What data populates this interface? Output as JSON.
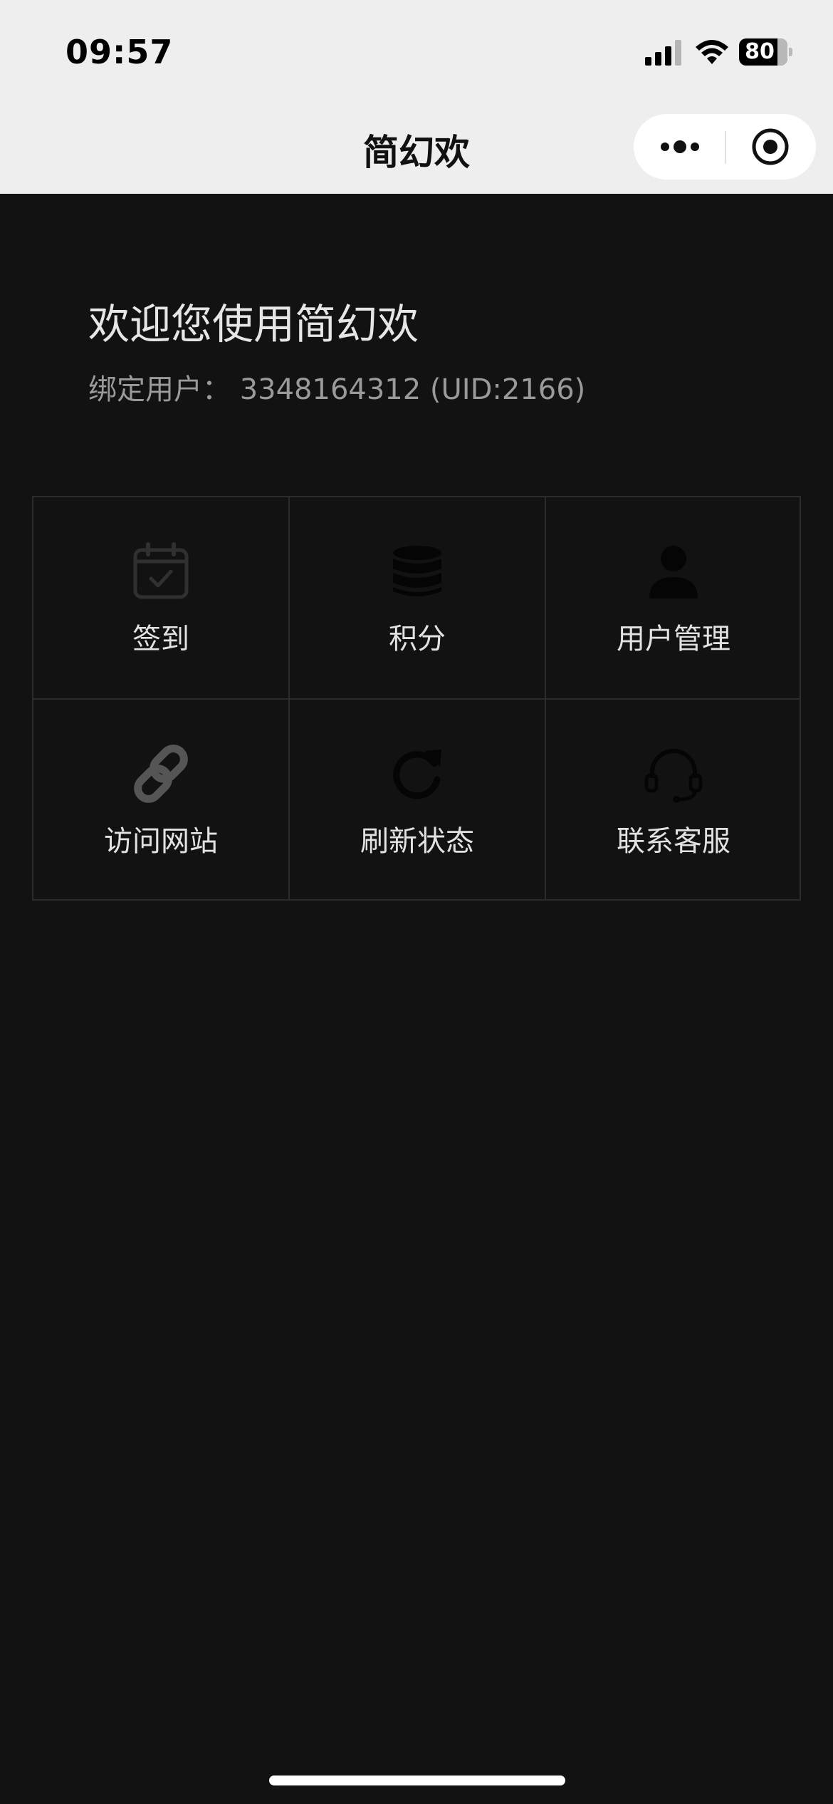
{
  "status_bar": {
    "time": "09:57",
    "battery_level": "80",
    "signal_icon": "signal-icon",
    "wifi_icon": "wifi-icon"
  },
  "nav": {
    "title": "简幻欢",
    "more_icon": "more-dots-icon",
    "close_icon": "capsule-close-icon"
  },
  "content": {
    "welcome": "欢迎您使用简幻欢",
    "bind_user": "绑定用户： 3348164312 (UID:2166)"
  },
  "grid": [
    {
      "label": "签到",
      "icon": "calendar-check-icon"
    },
    {
      "label": "积分",
      "icon": "database-coins-icon"
    },
    {
      "label": "用户管理",
      "icon": "user-icon"
    },
    {
      "label": "访问网站",
      "icon": "link-icon"
    },
    {
      "label": "刷新状态",
      "icon": "refresh-icon"
    },
    {
      "label": "联系客服",
      "icon": "headset-icon"
    }
  ],
  "colors": {
    "background": "#121212",
    "header": "#eeeeee",
    "icon_dim": "#303030",
    "icon_dark": "#050505",
    "icon_link": "#555555"
  }
}
